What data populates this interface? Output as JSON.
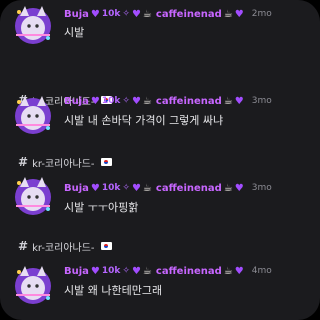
{
  "channel_name": "kr-코리아나드-",
  "user": {
    "name1": "Buja",
    "mid": "10k",
    "name2": "caffeinenad"
  },
  "icons": {
    "heart": "purple-heart-icon",
    "twinkle": "sparkle-icon",
    "coffee": "coffee-icon",
    "flag": "korea-flag-icon",
    "avatar": "purple-fox-avatar"
  },
  "colors": {
    "username": "#c766ff",
    "background": "#1b1b1e",
    "text": "#e7e7ea",
    "timestamp": "#8b8b93"
  },
  "messages": [
    {
      "time": "2mo",
      "text": "시발"
    },
    {
      "time": "3mo",
      "text": "시발 내 손바닥 가격이 그렇게 싸냐"
    },
    {
      "time": "3mo",
      "text": "시발 ㅜㅜ아핑핡"
    },
    {
      "time": "4mo",
      "text": "시발 왜 나한테만그래"
    }
  ]
}
